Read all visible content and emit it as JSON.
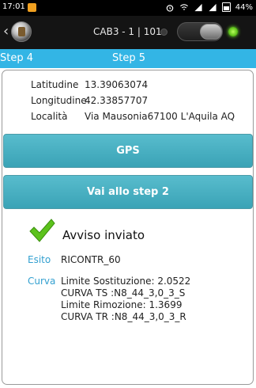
{
  "statusbar": {
    "time": "17:01",
    "battery": "44%"
  },
  "header": {
    "title": "CAB3 - 1 | 101"
  },
  "steps": {
    "previous": "Step 4",
    "current": "Step 5"
  },
  "location": {
    "lat_label": "Latitudine",
    "lat_value": "13.39063074",
    "lon_label": "Longitudine",
    "lon_value": "42.33857707",
    "loc_label": "Località",
    "loc_value": "Via Mausonia67100 L'Aquila AQ"
  },
  "buttons": {
    "gps": "GPS",
    "next": "Vai allo step 2"
  },
  "result": {
    "status": "Avviso inviato",
    "esito_label": "Esito",
    "esito_value": "RICONTR_60",
    "curva_label": "Curva",
    "curva_lines": [
      "Limite Sostituzione: 2.0522",
      "CURVA TS :N8_44_3,0_3_S",
      "Limite Rimozione: 1.3699",
      "CURVA TR :N8_44_3,0_3_R"
    ]
  },
  "colors": {
    "accent": "#33b5e5",
    "button": "#48b0c3",
    "check": "#5cc21c"
  }
}
